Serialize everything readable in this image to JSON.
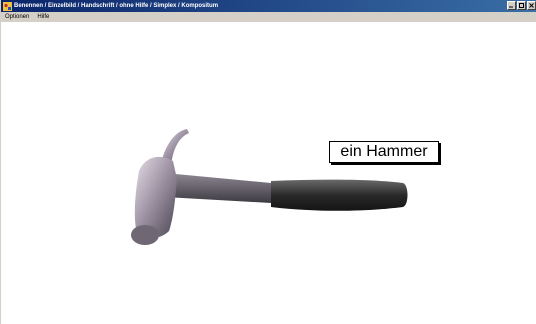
{
  "window": {
    "title": "Benennen / Einzelbild / Handschrift / ohne Hilfe / Simplex / Kompositum"
  },
  "menu": {
    "items": [
      {
        "label": "Optionen"
      },
      {
        "label": "Hilfe"
      }
    ]
  },
  "main": {
    "image_icon": "hammer-image",
    "label": "ein Hammer"
  },
  "colors": {
    "titlebar_start": "#0a246a",
    "titlebar_end": "#3a6ea5",
    "menubar": "#d4d0c8",
    "content_bg": "#ffffff"
  }
}
